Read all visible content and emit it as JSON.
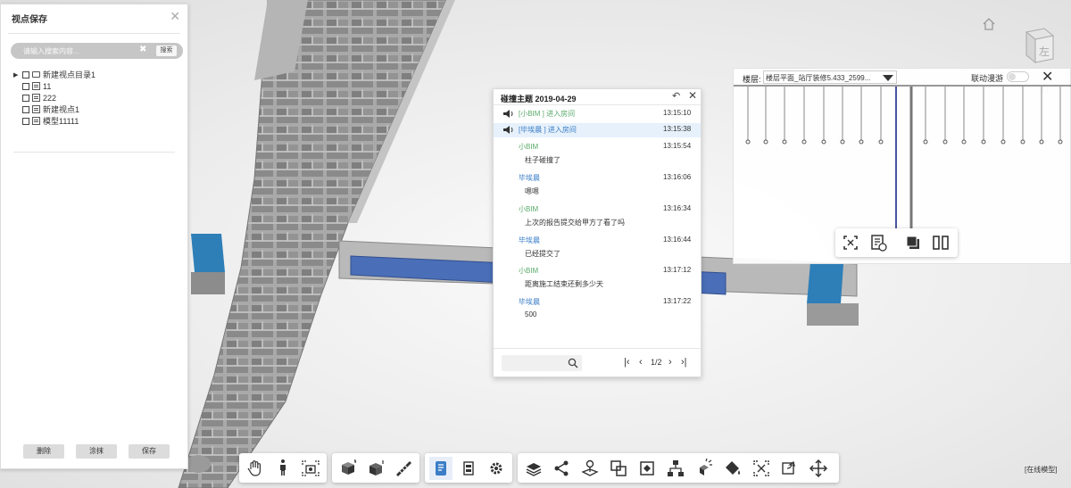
{
  "viewpoint_panel": {
    "title": "视点保存",
    "search_placeholder": "请输入搜索内容...",
    "search_button": "搜索",
    "tree": [
      {
        "label": "新建视点目录1",
        "type": "folder",
        "level": 0
      },
      {
        "label": "11",
        "type": "view",
        "level": 1
      },
      {
        "label": "222",
        "type": "view",
        "level": 1
      },
      {
        "label": "新建视点1",
        "type": "view",
        "level": 1
      },
      {
        "label": "模型11111",
        "type": "view",
        "level": 1
      }
    ],
    "buttons": {
      "delete": "删除",
      "paint": "涂抹",
      "save": "保存"
    }
  },
  "chat": {
    "title": "碰撞主题 2019-04-29",
    "messages": [
      {
        "kind": "system",
        "sender": "[小BIM ] 进入房间",
        "time": "13:15:10",
        "color": "green"
      },
      {
        "kind": "system",
        "sender": "[毕埃晨 ] 进入房间",
        "time": "13:15:38",
        "color": "blue",
        "highlight": true
      },
      {
        "kind": "chat",
        "sender": "小BIM",
        "time": "13:15:54",
        "text": "柱子碰撞了",
        "color": "green"
      },
      {
        "kind": "chat",
        "sender": "毕埃晨",
        "time": "13:16:06",
        "text": "嗯嗯",
        "color": "blue"
      },
      {
        "kind": "chat",
        "sender": "小BIM",
        "time": "13:16:34",
        "text": "上次的报告提交给甲方了看了吗",
        "color": "green"
      },
      {
        "kind": "chat",
        "sender": "毕埃晨",
        "time": "13:16:44",
        "text": "已经提交了",
        "color": "blue"
      },
      {
        "kind": "chat",
        "sender": "小BIM",
        "time": "13:17:12",
        "text": "距离施工结束还剩多少天",
        "color": "green"
      },
      {
        "kind": "chat",
        "sender": "毕埃晨",
        "time": "13:17:22",
        "text": "500",
        "color": "blue"
      }
    ],
    "pager": {
      "first": "|‹",
      "prev": "‹",
      "page": "1/2",
      "next": "›",
      "last": "›|"
    }
  },
  "floor_panel": {
    "label": "楼层:",
    "selected_floor": "楼层平面_站厅装修5.433_2599...",
    "linkage_label": "联动漫游",
    "linkage_on": false
  },
  "toolbar_groups": [
    {
      "name": "navigation",
      "tools": [
        "hand-icon",
        "person-walk-icon",
        "camera-viewpoint-icon"
      ]
    },
    {
      "name": "section",
      "tools": [
        "section-box-icon",
        "section-plane-icon",
        "measure-icon"
      ]
    },
    {
      "name": "data",
      "tools": [
        "property-icon",
        "floor-panel-icon",
        "settings-icon"
      ]
    },
    {
      "name": "model",
      "tools": [
        "layers-icon",
        "share-icon",
        "pin-icon",
        "compare-icon",
        "collision-icon",
        "structure-icon",
        "explode-icon",
        "paint-bucket-icon",
        "fit-view-icon",
        "rotate-icon",
        "move-icon"
      ]
    }
  ],
  "status_text": "[在线模型]",
  "accent_colors": {
    "highlight_beam": "#4a6fb8",
    "cyan_top": "#2e7fb8",
    "chat_green": "#5aaa6a",
    "chat_blue": "#3b7ec7"
  }
}
